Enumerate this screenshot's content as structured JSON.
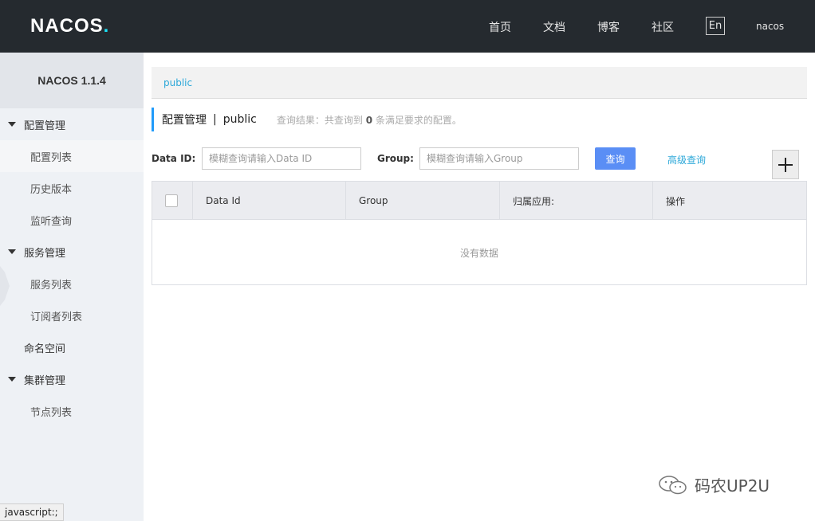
{
  "header": {
    "logo_text": "NACOS",
    "nav": [
      {
        "label": "首页"
      },
      {
        "label": "文档"
      },
      {
        "label": "博客"
      },
      {
        "label": "社区"
      }
    ],
    "lang_button": "En",
    "user": "nacos"
  },
  "sidebar": {
    "title": "NACOS 1.1.4",
    "config_group": "配置管理",
    "config_list": "配置列表",
    "history": "历史版本",
    "listen_query": "监听查询",
    "service_group": "服务管理",
    "service_list": "服务列表",
    "subscriber_list": "订阅者列表",
    "namespace": "命名空间",
    "cluster_group": "集群管理",
    "node_list": "节点列表"
  },
  "status_bar": "javascript:;",
  "breadcrumb": "public",
  "title": {
    "main": "配置管理",
    "separator": "|",
    "namespace": "public",
    "result_prefix": "查询结果：共查询到",
    "result_count": "0",
    "result_suffix": "条满足要求的配置。"
  },
  "search": {
    "data_id_label": "Data ID:",
    "data_id_placeholder": "模糊查询请输入Data ID",
    "group_label": "Group:",
    "group_placeholder": "模糊查询请输入Group",
    "query_button": "查询",
    "advanced_link": "高级查询"
  },
  "table": {
    "columns": [
      "Data Id",
      "Group",
      "归属应用:",
      "操作"
    ],
    "empty_text": "没有数据"
  },
  "watermark": "码农UP2U",
  "colors": {
    "header_bg": "#252a2f",
    "accent": "#209bfa",
    "link": "#2ca8d9",
    "primary_button": "#5a8ef5"
  }
}
